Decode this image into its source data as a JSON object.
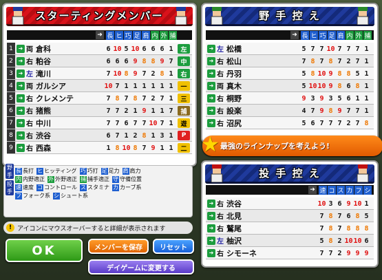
{
  "lineup": {
    "title": "スターティングメンバー",
    "headers": [
      "長",
      "ヒ",
      "巧",
      "足",
      "肩",
      "内",
      "外",
      "捕"
    ],
    "players": [
      {
        "num": "1",
        "hand": "両",
        "name": "倉科",
        "stats": [
          "6",
          "10",
          "5",
          "10",
          "6",
          "6",
          "6",
          "1"
        ],
        "pos": "左"
      },
      {
        "num": "2",
        "hand": "右",
        "name": "粕谷",
        "stats": [
          "6",
          "6",
          "6",
          "9",
          "8",
          "8",
          "9",
          "7"
        ],
        "pos": "中"
      },
      {
        "num": "3",
        "hand": "左",
        "name": "滝川",
        "stats": [
          "7",
          "10",
          "8",
          "9",
          "7",
          "2",
          "8",
          "1"
        ],
        "pos": "右"
      },
      {
        "num": "4",
        "hand": "両",
        "name": "ガルシア",
        "stats": [
          "10",
          "7",
          "1",
          "1",
          "1",
          "1",
          "1",
          "1"
        ],
        "pos": "一"
      },
      {
        "num": "5",
        "hand": "右",
        "name": "クレメンテ",
        "stats": [
          "7",
          "8",
          "7",
          "8",
          "7",
          "2",
          "7",
          "1"
        ],
        "pos": "三"
      },
      {
        "num": "6",
        "hand": "右",
        "name": "猪熊",
        "stats": [
          "7",
          "7",
          "2",
          "1",
          "9",
          "1",
          "1",
          "7"
        ],
        "pos": "捕"
      },
      {
        "num": "7",
        "hand": "右",
        "name": "中川",
        "stats": [
          "7",
          "7",
          "6",
          "7",
          "7",
          "10",
          "7",
          "1"
        ],
        "pos": "遊"
      },
      {
        "num": "8",
        "hand": "右",
        "name": "渋谷",
        "stats": [
          "6",
          "7",
          "1",
          "2",
          "8",
          "1",
          "3",
          "1"
        ],
        "pos": "P"
      },
      {
        "num": "9",
        "hand": "右",
        "name": "西森",
        "stats": [
          "1",
          "8",
          "10",
          "8",
          "7",
          "9",
          "1",
          "1"
        ],
        "pos": "二"
      }
    ]
  },
  "bench": {
    "title": "野 手 控 え",
    "headers": [
      "長",
      "ヒ",
      "巧",
      "足",
      "肩",
      "内",
      "外",
      "捕"
    ],
    "players": [
      {
        "hand": "左",
        "name": "松橋",
        "stats": [
          "5",
          "7",
          "7",
          "10",
          "7",
          "7",
          "7",
          "1"
        ]
      },
      {
        "hand": "右",
        "name": "松山",
        "stats": [
          "7",
          "8",
          "7",
          "8",
          "7",
          "2",
          "7",
          "1"
        ]
      },
      {
        "hand": "右",
        "name": "丹羽",
        "stats": [
          "5",
          "8",
          "10",
          "9",
          "8",
          "8",
          "5",
          "1"
        ]
      },
      {
        "hand": "両",
        "name": "真木",
        "stats": [
          "5",
          "10",
          "10",
          "9",
          "8",
          "6",
          "8",
          "1"
        ]
      },
      {
        "hand": "右",
        "name": "桐野",
        "stats": [
          "9",
          "3",
          "9",
          "3",
          "5",
          "6",
          "1",
          "1"
        ]
      },
      {
        "hand": "右",
        "name": "設楽",
        "stats": [
          "4",
          "7",
          "9",
          "8",
          "9",
          "7",
          "7",
          "1"
        ]
      },
      {
        "hand": "右",
        "name": "沼尻",
        "stats": [
          "5",
          "6",
          "7",
          "7",
          "7",
          "2",
          "7",
          "8"
        ]
      }
    ]
  },
  "banner": "最強のラインナップを考えよう!",
  "pitchers": {
    "title": "投 手 控 え",
    "headers": [
      "速",
      "コ",
      "ス",
      "カ",
      "フ",
      "シ"
    ],
    "players": [
      {
        "hand": "右",
        "name": "渋谷",
        "stats": [
          "10",
          "3",
          "6",
          "9",
          "10",
          "1"
        ]
      },
      {
        "hand": "右",
        "name": "北見",
        "stats": [
          "7",
          "8",
          "7",
          "6",
          "8",
          "5"
        ]
      },
      {
        "hand": "右",
        "name": "鷲尾",
        "stats": [
          "7",
          "8",
          "7",
          "8",
          "8",
          "8"
        ]
      },
      {
        "hand": "左",
        "name": "柚沢",
        "stats": [
          "5",
          "8",
          "2",
          "10",
          "10",
          "6"
        ]
      },
      {
        "hand": "右",
        "name": "シモーネ",
        "stats": [
          "7",
          "7",
          "2",
          "9",
          "9",
          "9"
        ]
      }
    ]
  },
  "legend": {
    "tag1": "野手",
    "tag2": "投手",
    "row1": [
      [
        "長",
        "長打"
      ],
      [
        "ヒ",
        "ヒッティング"
      ],
      [
        "巧",
        "巧打"
      ],
      [
        "足",
        "足力"
      ],
      [
        "肩",
        "肩力"
      ]
    ],
    "row2": [
      [
        "内",
        "内野適正"
      ],
      [
        "外",
        "外野適正"
      ],
      [
        "捕",
        "捕手適正"
      ],
      [
        "守",
        "守備位置"
      ]
    ],
    "row3": [
      [
        "速",
        "速度"
      ],
      [
        "コ",
        "コントロール"
      ],
      [
        "ス",
        "スタミナ"
      ],
      [
        "カ",
        "カーブ系"
      ]
    ],
    "row4": [
      [
        "フ",
        "フォーク系"
      ],
      [
        "シ",
        "シュート系"
      ]
    ]
  },
  "info": "アイコンにマウスオーバーすると詳細が表示されます",
  "buttons": {
    "ok": "OK",
    "save": "メンバーを保存",
    "reset": "リセット",
    "day": "デイゲームに変更する"
  }
}
